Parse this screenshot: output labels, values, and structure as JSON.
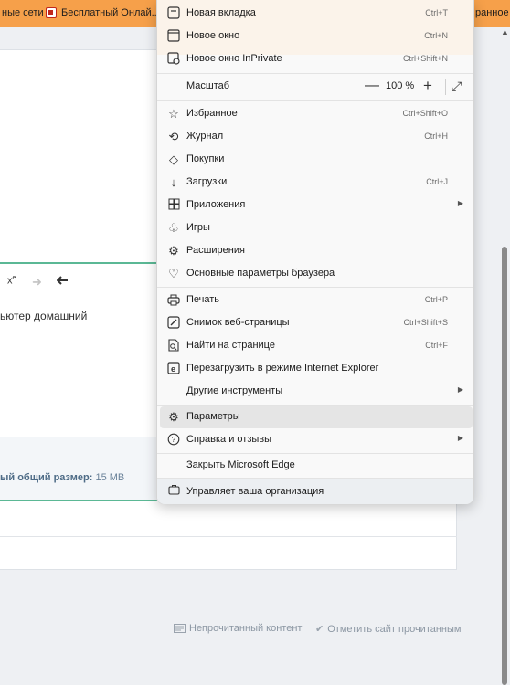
{
  "bookmarks": {
    "item1": "ные сети",
    "item2": "Бесплатный Онлай...",
    "item3": "ранное"
  },
  "page": {
    "editor_text": "ьютер домашний",
    "attach_label": "ый общий размер:",
    "attach_value": "15 MB",
    "unread_link": "Непрочитанный контент",
    "mark_read_link": "Отметить сайт прочитанным"
  },
  "menu": {
    "new_tab": {
      "label": "Новая вкладка",
      "shortcut": "Ctrl+T"
    },
    "new_window": {
      "label": "Новое окно",
      "shortcut": "Ctrl+N"
    },
    "new_inprivate": {
      "label": "Новое окно InPrivate",
      "shortcut": "Ctrl+Shift+N"
    },
    "zoom": {
      "label": "Масштаб",
      "value": "100 %",
      "minus": "—",
      "plus": "+"
    },
    "favorites": {
      "label": "Избранное",
      "shortcut": "Ctrl+Shift+O"
    },
    "history": {
      "label": "Журнал",
      "shortcut": "Ctrl+H"
    },
    "shopping": {
      "label": "Покупки"
    },
    "downloads": {
      "label": "Загрузки",
      "shortcut": "Ctrl+J"
    },
    "apps": {
      "label": "Приложения"
    },
    "games": {
      "label": "Игры"
    },
    "extensions": {
      "label": "Расширения"
    },
    "browser_essentials": {
      "label": "Основные параметры браузера"
    },
    "print": {
      "label": "Печать",
      "shortcut": "Ctrl+P"
    },
    "screenshot": {
      "label": "Снимок веб-страницы",
      "shortcut": "Ctrl+Shift+S"
    },
    "find": {
      "label": "Найти на странице",
      "shortcut": "Ctrl+F"
    },
    "ie_mode": {
      "label": "Перезагрузить в режиме Internet Explorer"
    },
    "more_tools": {
      "label": "Другие инструменты"
    },
    "settings": {
      "label": "Параметры"
    },
    "help": {
      "label": "Справка и отзывы"
    },
    "close_edge": {
      "label": "Закрыть Microsoft Edge"
    },
    "managed": {
      "label": "Управляет ваша организация"
    }
  }
}
